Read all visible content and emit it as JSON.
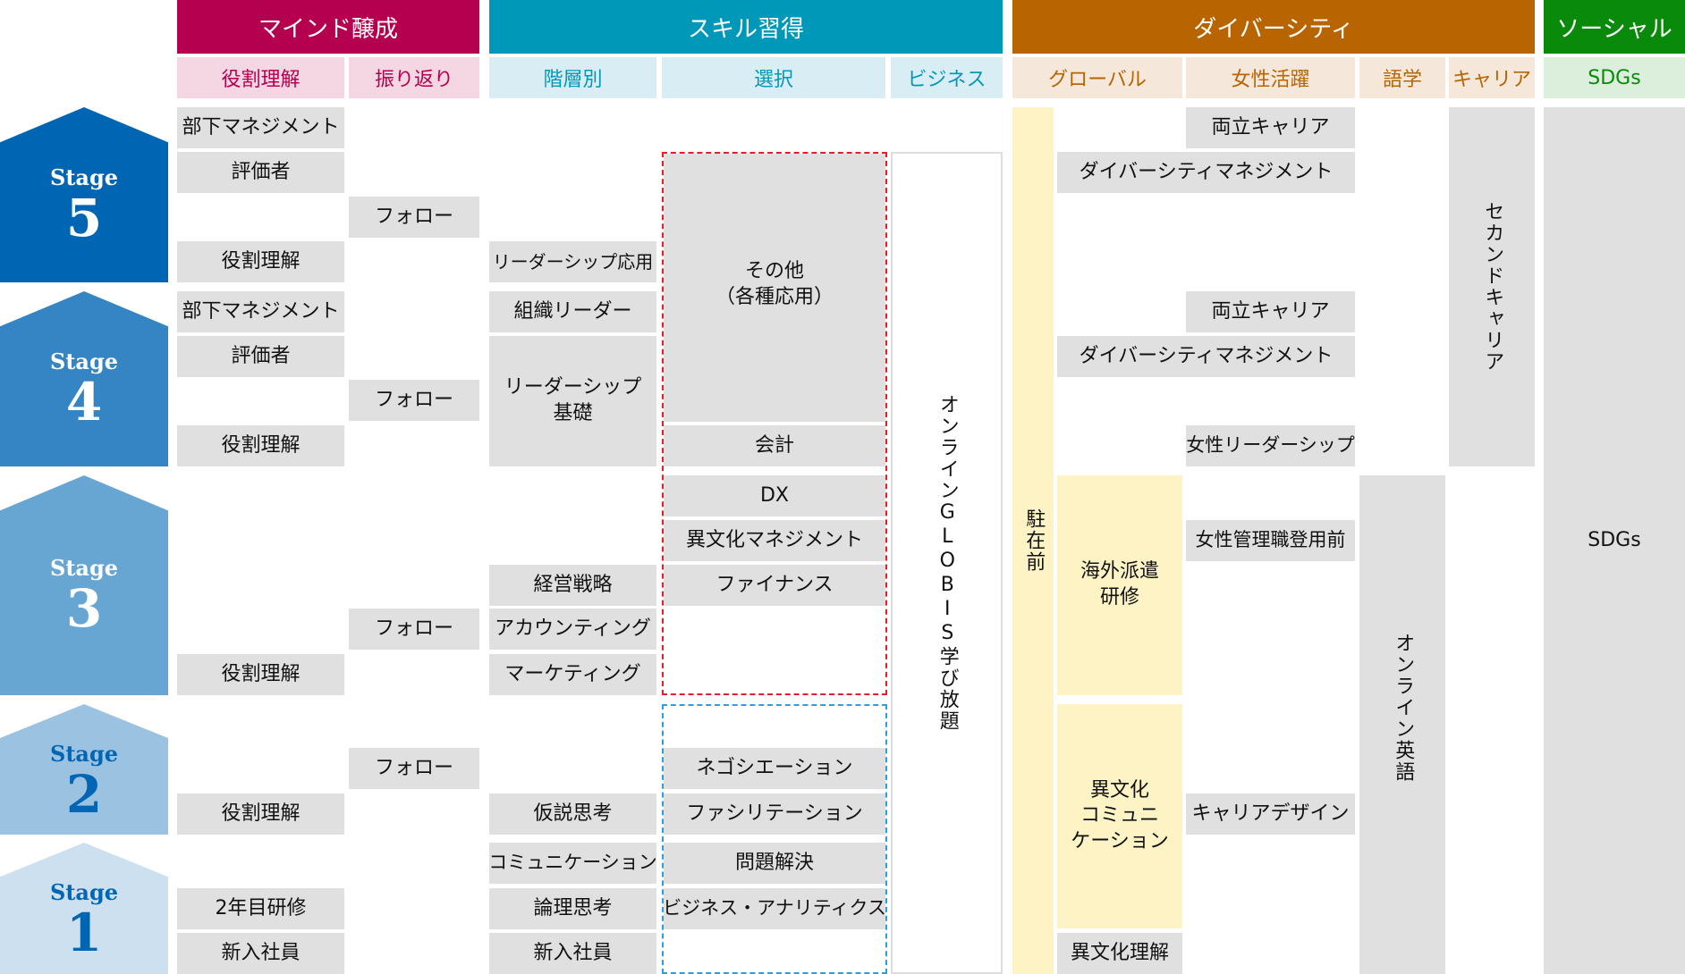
{
  "colors": {
    "mind": "#b5004f",
    "mind_sub": "#f5d6e3",
    "mind_sub_text": "#b5004f",
    "skill": "#0098b8",
    "skill_sub": "#d9eef4",
    "skill_sub_text": "#0098b8",
    "diversity": "#b86400",
    "diversity_sub": "#f5e8da",
    "diversity_sub_text": "#b86400",
    "social": "#0a8a0a",
    "social_sub": "#dcefdc",
    "social_sub_text": "#0a8a0a",
    "stage5": "#0066b3",
    "stage4": "#3584c4",
    "stage3": "#67a5d3",
    "stage2": "#9cc2e1",
    "stage1": "#cce0ef"
  },
  "headers": {
    "mind": "マインド醸成",
    "skill": "スキル習得",
    "diversity": "ダイバーシティ",
    "social": "ソーシャル"
  },
  "subheaders": {
    "role": "役割理解",
    "reflect": "振り返り",
    "tier": "階層別",
    "select": "選択",
    "business": "ビジネス",
    "global": "グローバル",
    "women": "女性活躍",
    "language": "語学",
    "career": "キャリア",
    "sdgs": "SDGs"
  },
  "stages": [
    {
      "label": "Stage",
      "num": "5"
    },
    {
      "label": "Stage",
      "num": "4"
    },
    {
      "label": "Stage",
      "num": "3"
    },
    {
      "label": "Stage",
      "num": "2"
    },
    {
      "label": "Stage",
      "num": "1"
    }
  ],
  "role": {
    "s5_mgmt": "部下マネジメント",
    "s5_eval": "評価者",
    "s5_role": "役割理解",
    "s4_mgmt": "部下マネジメント",
    "s4_eval": "評価者",
    "s4_role": "役割理解",
    "s3_role": "役割理解",
    "s2_role": "役割理解",
    "s1_second": "2年目研修",
    "s1_new": "新入社員"
  },
  "reflect": {
    "s5": "フォロー",
    "s4": "フォロー",
    "s3": "フォロー",
    "s2": "フォロー"
  },
  "tier": {
    "lead_adv": "リーダーシップ応用",
    "org_leader": "組織リーダー",
    "lead_basic": "リーダーシップ\n基礎",
    "strategy": "経営戦略",
    "accounting": "アカウンティング",
    "marketing": "マーケティング",
    "hypothesis": "仮説思考",
    "communication": "コミュニケーション",
    "logic": "論理思考",
    "new": "新入社員"
  },
  "select": {
    "other": "その他\n（各種応用）",
    "kaikei": "会計",
    "dx": "DX",
    "cross_mgmt": "異文化マネジメント",
    "finance": "ファイナンス",
    "negotiation": "ネゴシエーション",
    "facilitation": "ファシリテーション",
    "problem": "問題解決",
    "analytics": "ビジネス・アナリティクス"
  },
  "business": {
    "globis": "オンラインGLOBIS学び放題"
  },
  "global": {
    "pre_post": "駐在前",
    "overseas": "海外派遣\n研修",
    "cross_comm": "異文化\nコミュニ\nケーション",
    "cross_understand": "異文化理解"
  },
  "women": {
    "s5_balance": "両立キャリア",
    "s5_div": "ダイバーシティマネジメント",
    "s4_balance": "両立キャリア",
    "s4_div": "ダイバーシティマネジメント",
    "s4_leader": "女性リーダーシップ",
    "s3_pre_mgr": "女性管理職登用前",
    "s2_design": "キャリアデザイン"
  },
  "language": {
    "english": "オンライン英語"
  },
  "career": {
    "second": "セカンドキャリア"
  },
  "social": {
    "sdgs": "SDGs"
  }
}
